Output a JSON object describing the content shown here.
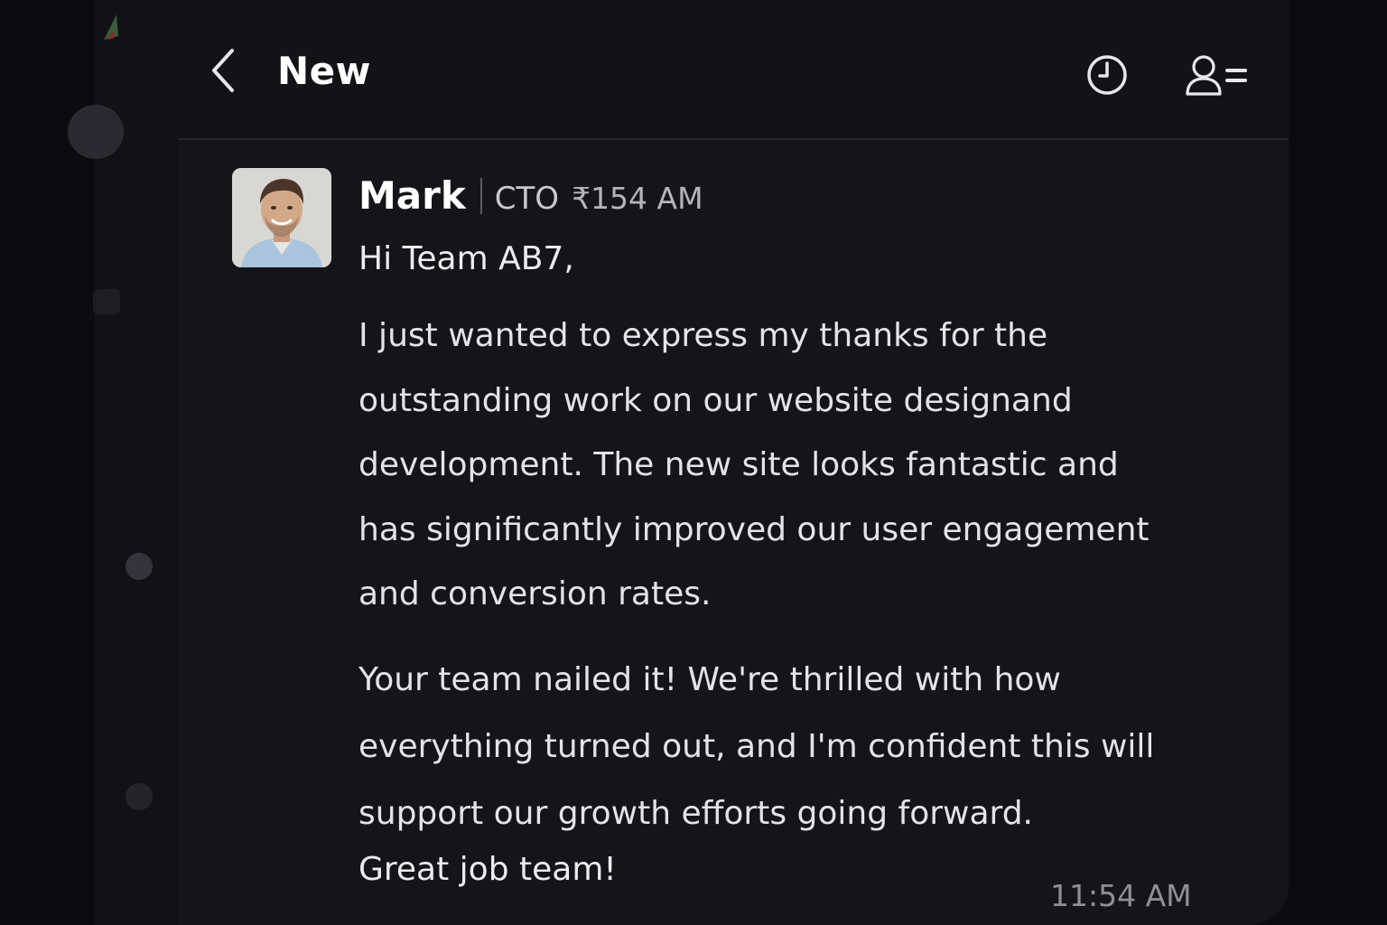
{
  "header": {
    "title": "New"
  },
  "message": {
    "sender": "Mark",
    "role": "CTO",
    "header_time": "₹154 AM",
    "greeting": "Hi Team AB7,",
    "paragraph1_lines": [
      "I just wanted to express my thanks for the",
      "outstanding work on our website designand",
      "development. The new site looks fantastic and",
      "has significantly improved our user engagement",
      "and conversion rates."
    ],
    "paragraph2_lines": [
      "Your team nailed it! We're thrilled with how",
      "everything turned out, and I'm confident this will",
      "support our growth efforts going forward."
    ],
    "closing": "Great job team!",
    "footer_time": "11:54 AM"
  },
  "icons": {
    "back": "chevron-left-icon",
    "history": "clock-icon",
    "members": "user-list-icon"
  },
  "colors": {
    "background": "#0c0c10",
    "panel": "#141419",
    "text": "#e4e4e8",
    "muted": "#8f8f96"
  }
}
